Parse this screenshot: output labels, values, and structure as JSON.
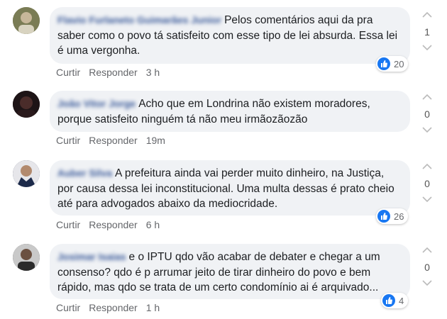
{
  "comments": [
    {
      "author": "Flavio Furlaneto Guimarães Junior",
      "text": "Pelos comentários aqui da pra saber como o povo tá satisfeito com esse tipo de lei absurda. Essa lei é uma vergonha.",
      "actions": {
        "like": "Curtir",
        "reply": "Responder",
        "time": "3 h"
      },
      "reactions": "20",
      "votes": "1"
    },
    {
      "author": "João Vitor Jorge",
      "text": "Acho que em Londrina não existem moradores, porque satisfeito ninguém tá não meu irmãozãozão",
      "actions": {
        "like": "Curtir",
        "reply": "Responder",
        "time": "19m"
      },
      "reactions": "",
      "votes": "0"
    },
    {
      "author": "Auber Silva",
      "text": "A prefeitura ainda vai perder muito dinheiro, na Justiça, por causa dessa lei inconstitucional. Uma multa dessas é prato cheio até para advogados abaixo da mediocridade.",
      "actions": {
        "like": "Curtir",
        "reply": "Responder",
        "time": "6 h"
      },
      "reactions": "26",
      "votes": "0"
    },
    {
      "author": "Josimar Isaias",
      "text": "e o IPTU qdo vão acabar de debater e chegar a um consenso? qdo é p arrumar jeito de tirar dinheiro do povo e bem rápido, mas qdo se trata de um certo condomínio ai é arquivado...",
      "actions": {
        "like": "Curtir",
        "reply": "Responder",
        "time": "1 h"
      },
      "reactions": "4",
      "votes": "0"
    }
  ],
  "colors": {
    "bubble": "#f0f2f5",
    "author": "#385898",
    "like": "#1877f2",
    "meta": "#65676b"
  }
}
